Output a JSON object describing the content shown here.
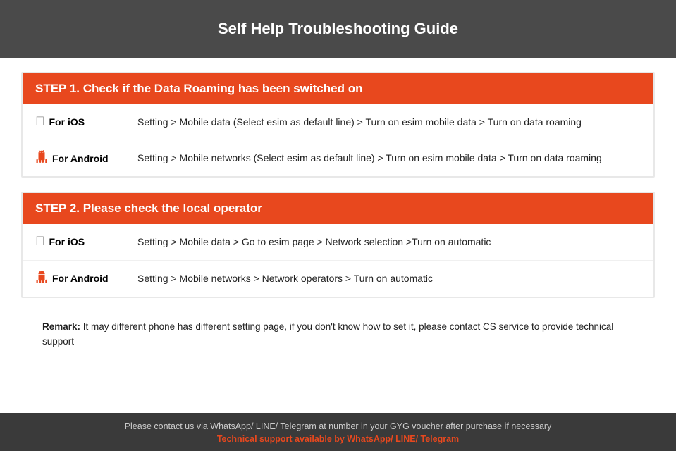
{
  "header": {
    "title": "Self Help Troubleshooting Guide"
  },
  "step1": {
    "title": "STEP 1.  Check if the Data Roaming has been switched on",
    "ios": {
      "label": "For iOS",
      "text": "Setting > Mobile data (Select esim as default line) > Turn on esim mobile data > Turn on data roaming"
    },
    "android": {
      "label": "For Android",
      "text": "Setting > Mobile networks (Select esim as default line) > Turn on esim mobile data > Turn on data roaming"
    }
  },
  "step2": {
    "title": "STEP 2.  Please check the local operator",
    "ios": {
      "label": "For iOS",
      "text": "Setting > Mobile data > Go to esim page > Network selection >Turn on automatic"
    },
    "android": {
      "label": "For Android",
      "text": "Setting > Mobile networks > Network operators > Turn on automatic"
    }
  },
  "remark": {
    "label": "Remark:",
    "text": "It may different phone has different setting page, if you don't know how to set it,  please contact CS service to provide technical support"
  },
  "footer": {
    "contact_text": "Please contact us via WhatsApp/ LINE/ Telegram at number in your GYG voucher after purchase if necessary",
    "support_text": "Technical support available by WhatsApp/ LINE/ Telegram"
  }
}
